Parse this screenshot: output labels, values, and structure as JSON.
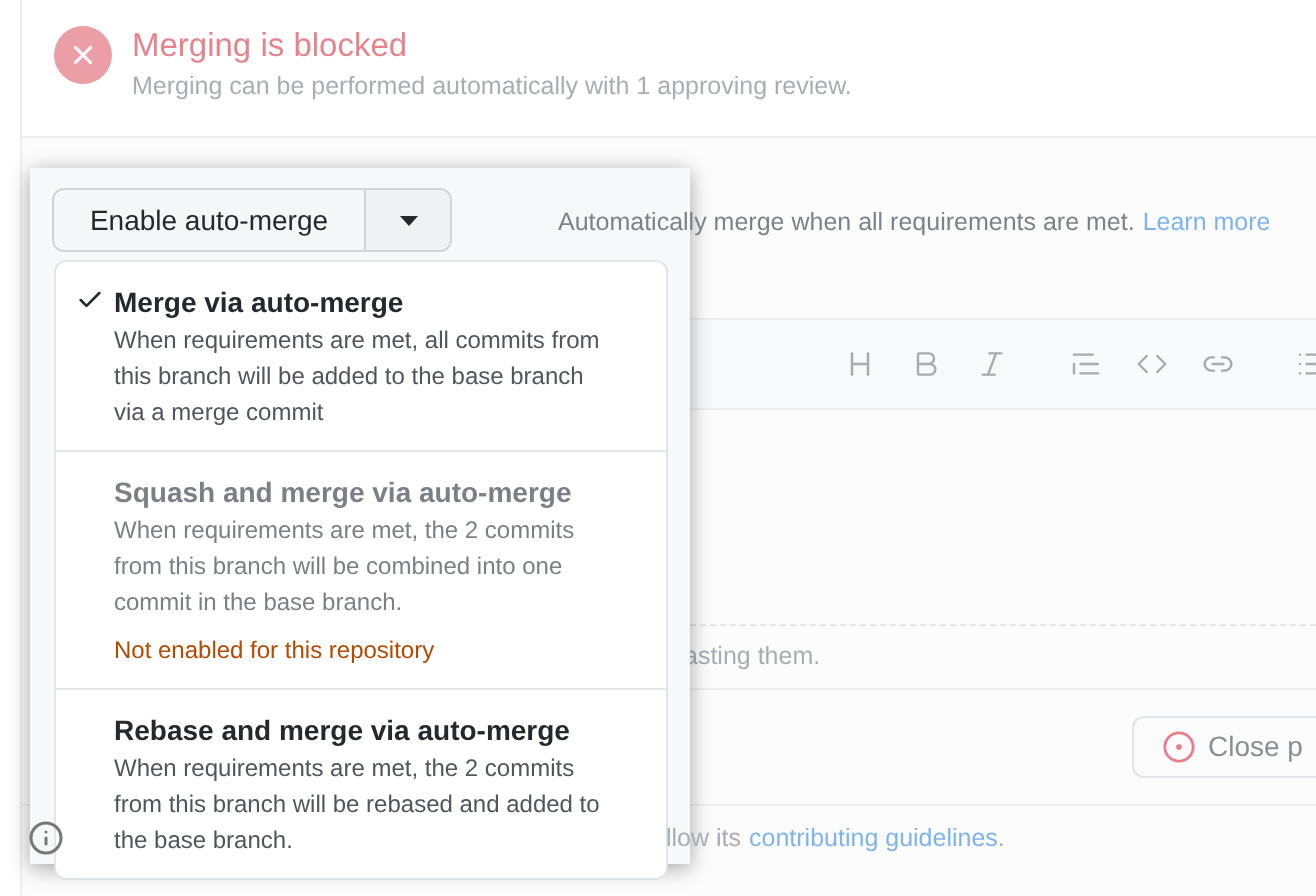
{
  "merge_status": {
    "title": "Merging is blocked",
    "description": "Merging can be performed automatically with 1 approving review."
  },
  "auto_merge": {
    "button": "Enable auto-merge",
    "hint": "Automatically merge when all requirements are met.",
    "link": "Learn more"
  },
  "merge_menu": [
    {
      "title": "Merge via auto-merge",
      "description": "When requirements are met, all commits from this branch will be added to the base branch via a merge commit",
      "selected": true,
      "disabled": false
    },
    {
      "title": "Squash and merge via auto-merge",
      "description": "When requirements are met, the 2 commits from this branch will be combined into one commit in the base branch.",
      "selected": false,
      "disabled": true,
      "note": "Not enabled for this repository"
    },
    {
      "title": "Rebase and merge via auto-merge",
      "description": "When requirements are met, the 2 commits from this branch will be rebased and added to the base branch.",
      "selected": false,
      "disabled": false
    }
  ],
  "editor_hint": "asting them.",
  "close_button": "Close p",
  "footer": {
    "text": "llow its",
    "link": "contributing guidelines",
    "end": "."
  }
}
